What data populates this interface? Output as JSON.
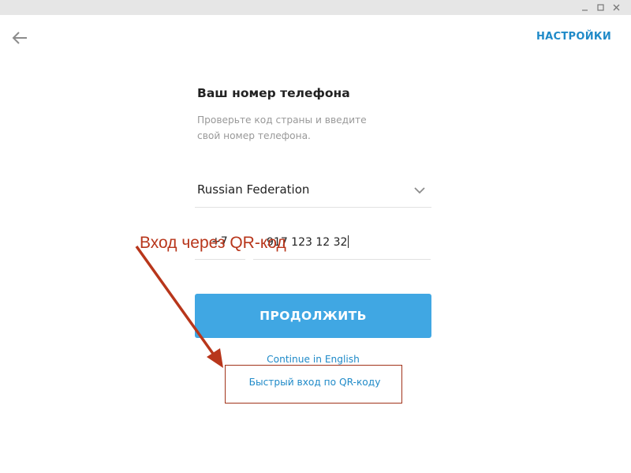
{
  "window": {
    "controls": [
      {
        "icon": "minimize-icon"
      },
      {
        "icon": "maximize-icon"
      },
      {
        "icon": "close-icon"
      }
    ]
  },
  "header": {
    "back_icon": "arrow-left-icon",
    "settings_label": "НАСТРОЙКИ"
  },
  "login": {
    "title": "Ваш номер телефона",
    "subtitle_line1": "Проверьте код страны и введите",
    "subtitle_line2": "свой номер телефона.",
    "country": "Russian Federation",
    "country_icon": "chevron-down-icon",
    "country_code": "+7",
    "phone_number": "917 123 12 32",
    "continue_label": "ПРОДОЛЖИТЬ",
    "english_link": "Continue in English",
    "qr_link": "Быстрый вход по QR-коду"
  },
  "annotation": {
    "text": "Вход через QR-код",
    "color": "#b8361b"
  },
  "colors": {
    "accent": "#40a7e3",
    "link": "#1f8ac8"
  }
}
